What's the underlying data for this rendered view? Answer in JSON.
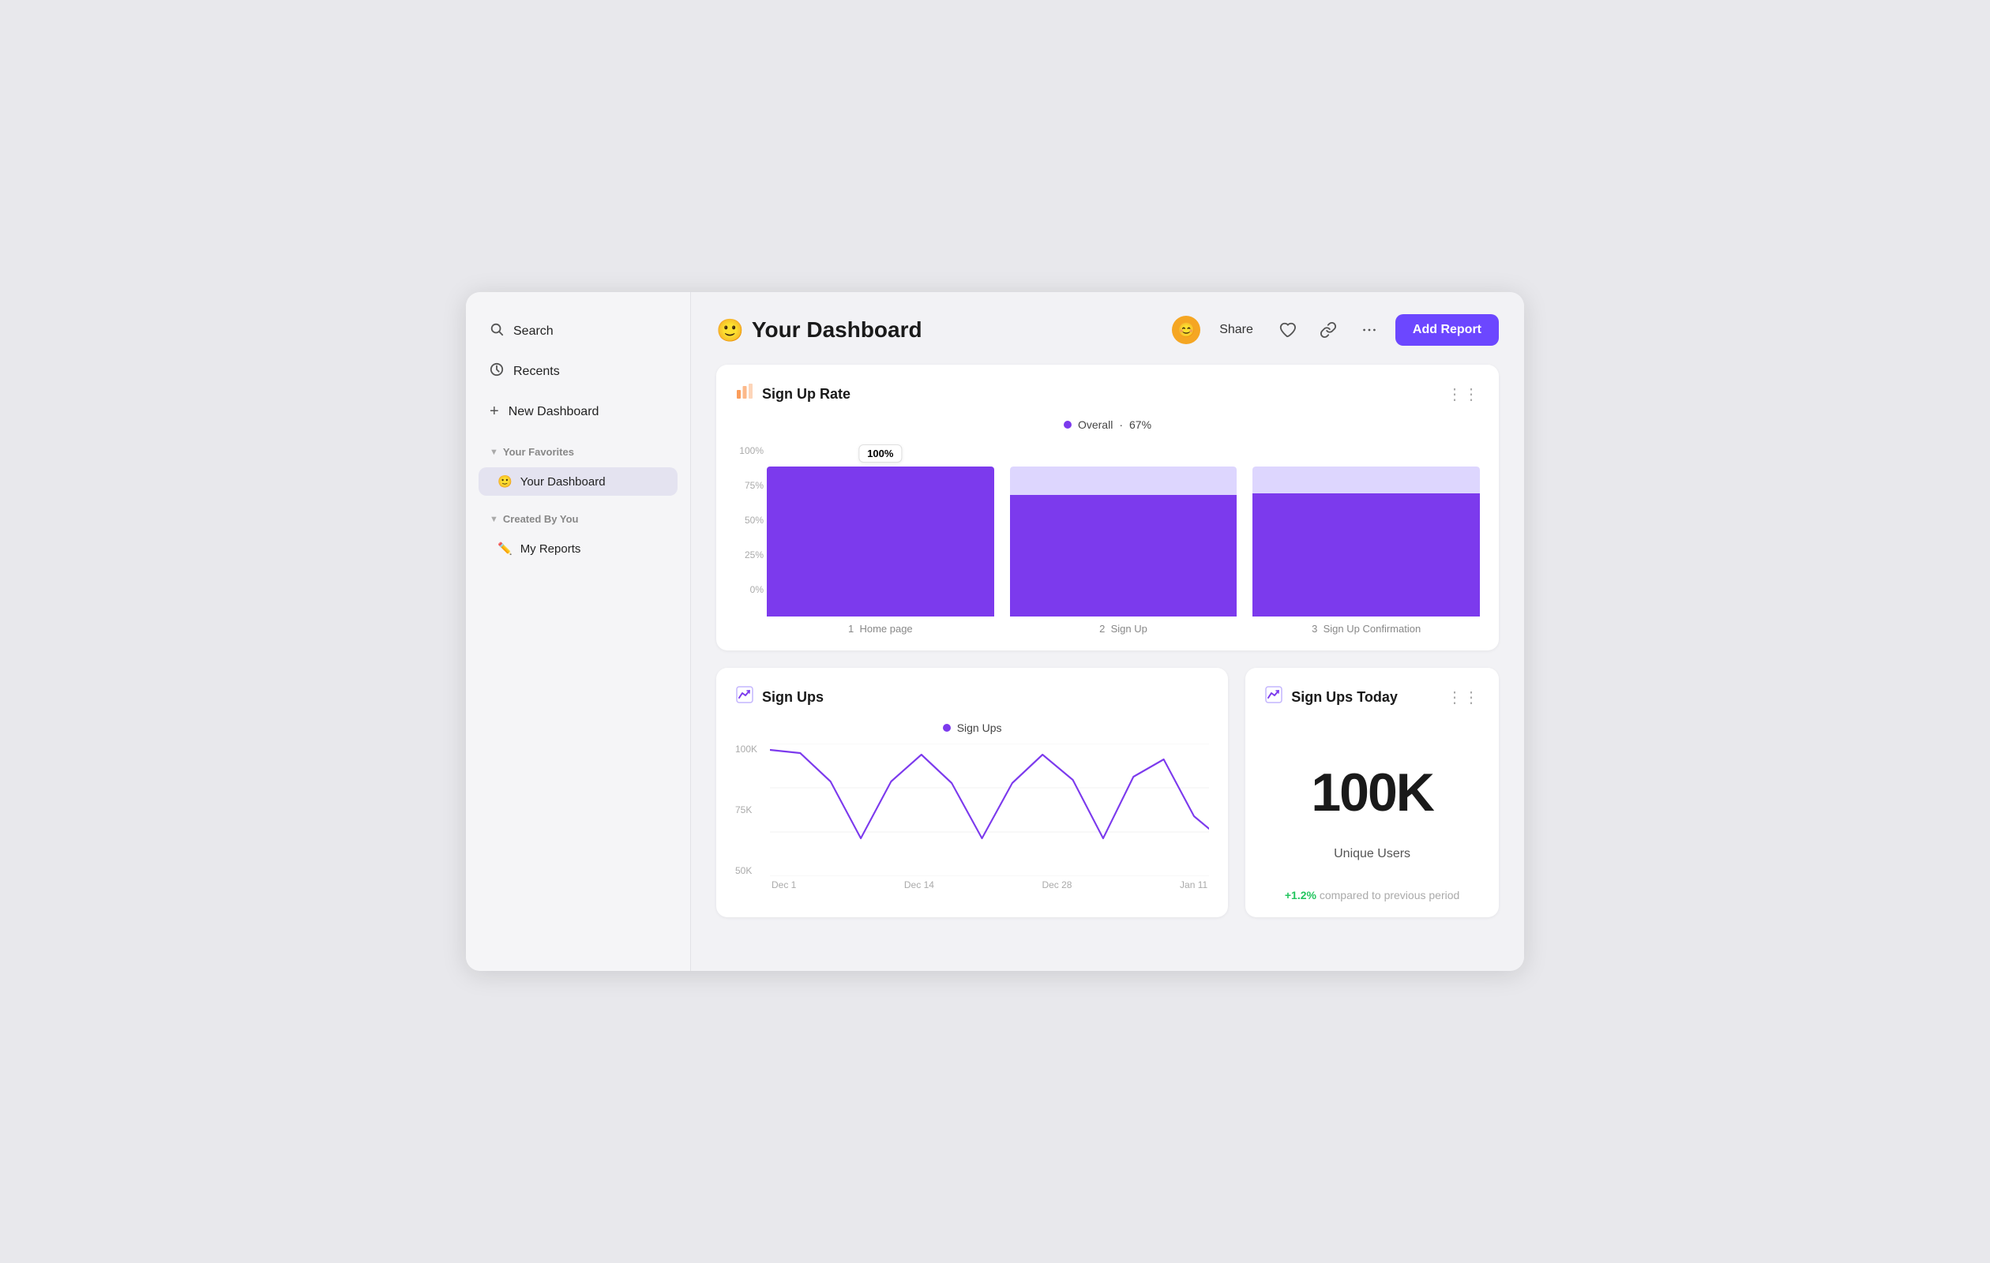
{
  "sidebar": {
    "search_label": "Search",
    "recents_label": "Recents",
    "new_dashboard_label": "New Dashboard",
    "favorites_section": "Your Favorites",
    "your_dashboard_item": "Your Dashboard",
    "your_dashboard_emoji": "🙂",
    "created_by_you_section": "Created By You",
    "my_reports_item": "My Reports",
    "my_reports_emoji": "✏️"
  },
  "header": {
    "title": "Your Dashboard",
    "title_emoji": "🙂",
    "share_label": "Share",
    "add_report_label": "Add Report"
  },
  "signup_rate_card": {
    "title": "Sign Up Rate",
    "legend_label": "Overall",
    "legend_value": "67%",
    "bars": [
      {
        "label": "1  Home page",
        "pct": 100,
        "pct_label": "100%",
        "color": "#7c3aed"
      },
      {
        "label": "2  Sign Up",
        "pct": 81,
        "pct_label": "81%",
        "color_bottom": "#7c3aed",
        "color_top": "#ddd6fe"
      },
      {
        "label": "3  Sign Up Confirmation",
        "pct": 82,
        "pct_label": "82%",
        "color_bottom": "#7c3aed",
        "color_top": "#ddd6fe"
      }
    ],
    "y_labels": [
      "100%",
      "75%",
      "50%",
      "25%",
      "0%"
    ]
  },
  "signups_card": {
    "title": "Sign Ups",
    "legend_label": "Sign Ups",
    "y_labels": [
      "100K",
      "75K",
      "50K"
    ],
    "x_labels": [
      "Dec 1",
      "Dec 14",
      "Dec 28",
      "Jan 11"
    ]
  },
  "signups_today_card": {
    "title": "Sign Ups Today",
    "big_number": "100K",
    "unique_users_label": "Unique Users",
    "change_value": "+1.2%",
    "change_label": "compared to previous period"
  }
}
